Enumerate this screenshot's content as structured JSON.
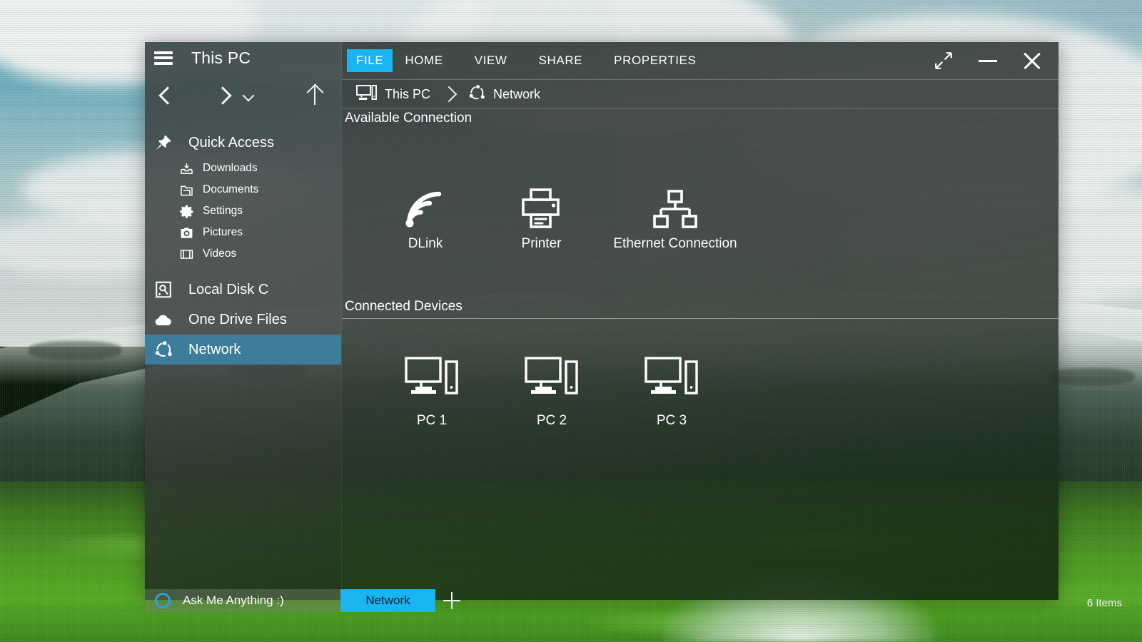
{
  "desktop": {
    "status_items": "6 Items"
  },
  "window": {
    "sidebar": {
      "menu_icon": "hamburger-icon",
      "title": "This PC",
      "nav": {
        "back": "back-arrow-icon",
        "forward": "forward-arrow-icon",
        "history": "chevron-down-icon",
        "up": "up-arrow-icon"
      },
      "items": [
        {
          "label": "Quick Access",
          "icon": "pin-icon",
          "level": 1,
          "selected": false
        },
        {
          "label": "Downloads",
          "icon": "download-icon",
          "level": 2,
          "selected": false
        },
        {
          "label": "Documents",
          "icon": "folder-icon",
          "level": 2,
          "selected": false
        },
        {
          "label": "Settings",
          "icon": "gear-icon",
          "level": 2,
          "selected": false
        },
        {
          "label": "Pictures",
          "icon": "camera-icon",
          "level": 2,
          "selected": false
        },
        {
          "label": "Videos",
          "icon": "film-icon",
          "level": 2,
          "selected": false
        },
        {
          "label": "Local Disk C",
          "icon": "hard-disk-icon",
          "level": 1,
          "selected": false
        },
        {
          "label": "One Drive Files",
          "icon": "cloud-icon",
          "level": 1,
          "selected": false
        },
        {
          "label": "Network",
          "icon": "network-icon",
          "level": 1,
          "selected": true
        }
      ]
    },
    "ribbon": {
      "tabs": [
        {
          "label": "FILE",
          "active": true
        },
        {
          "label": "HOME",
          "active": false
        },
        {
          "label": "VIEW",
          "active": false
        },
        {
          "label": "SHARE",
          "active": false
        },
        {
          "label": "PROPERTIES",
          "active": false
        }
      ],
      "controls": {
        "maximize": "maximize-icon",
        "minimize": "minimize-icon",
        "close": "close-icon"
      }
    },
    "breadcrumb": [
      {
        "label": "This PC",
        "icon": "this-pc-icon"
      },
      {
        "label": "Network",
        "icon": "network-icon"
      }
    ],
    "sections": [
      {
        "heading": "Available Connection",
        "tiles": [
          {
            "label": "DLink",
            "icon": "wifi-icon"
          },
          {
            "label": "Printer",
            "icon": "printer-icon"
          },
          {
            "label": "Ethernet Connection",
            "icon": "ethernet-icon"
          }
        ]
      },
      {
        "heading": "Connected Devices",
        "tiles": [
          {
            "label": "PC 1",
            "icon": "desktop-computer-icon"
          },
          {
            "label": "PC 2",
            "icon": "desktop-computer-icon"
          },
          {
            "label": "PC 3",
            "icon": "desktop-computer-icon"
          }
        ]
      }
    ]
  },
  "taskbar": {
    "cortana_label": "Ask Me Anything :)",
    "cortana_icon": "cortana-ring-icon",
    "active_tab": "Network",
    "add_tab_icon": "plus-icon"
  },
  "colors": {
    "accent": "#1ab4f0",
    "selection": "#3d7d9c",
    "text": "#ffffff"
  }
}
